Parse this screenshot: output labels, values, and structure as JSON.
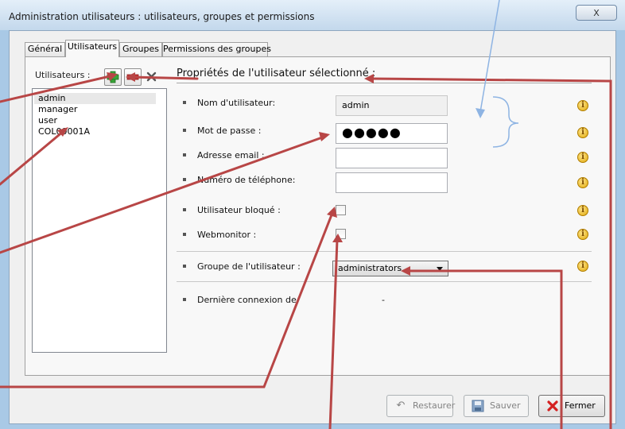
{
  "window": {
    "title": "Administration utilisateurs : utilisateurs, groupes et permissions",
    "close_label": "X"
  },
  "tabs": [
    {
      "label": "Général"
    },
    {
      "label": "Utilisateurs"
    },
    {
      "label": "Groupes"
    },
    {
      "label": "Permissions des groupes"
    }
  ],
  "users_panel": {
    "label": "Utilisateurs :",
    "items": [
      "admin",
      "manager",
      "user",
      "COL00001A"
    ],
    "selected_index": 0
  },
  "properties": {
    "title": "Propriétés de l'utilisateur sélectionné :",
    "username_label": "Nom d'utilisateur:",
    "username_value": "admin",
    "password_label": "Mot de passe :",
    "password_value": "●●●●●",
    "email_label": "Adresse email :",
    "email_value": "",
    "phone_label": "Numéro de téléphone:",
    "phone_value": "",
    "blocked_label": "Utilisateur bloqué :",
    "blocked_checked": false,
    "webmonitor_label": "Webmonitor :",
    "webmonitor_checked": false,
    "group_label": "Groupe de l'utilisateur :",
    "group_value": "administrators",
    "last_login_label": "Dernière connexion de",
    "last_login_value": "-"
  },
  "buttons": {
    "restore": "Restaurer",
    "save": "Sauver",
    "close": "Fermer"
  },
  "colors": {
    "annotation_arrow": "#b84646",
    "annotation_blue": "#8eb4e3",
    "add_green": "#3aa53a",
    "remove_red": "#d03030"
  },
  "icons": {
    "add": "add-user-icon",
    "remove": "remove-user-icon",
    "delete": "delete-x-icon",
    "info": "info-icon",
    "restore": "undo-icon",
    "save": "floppy-disk-icon",
    "close": "red-x-icon"
  }
}
